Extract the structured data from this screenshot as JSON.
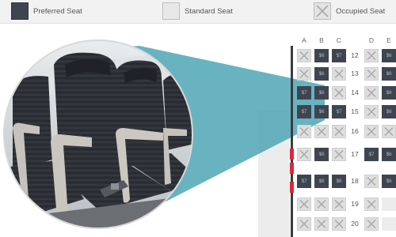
{
  "legend": {
    "preferred": "Preferred Seat",
    "standard": "Standard Seat",
    "occupied": "Occupied Seat"
  },
  "columns": [
    "A",
    "B",
    "C",
    "D",
    "E"
  ],
  "seat_label_text": "$6",
  "rows": [
    {
      "number": "12",
      "seats": [
        "occupied",
        "preferred",
        "preferred",
        "occupied",
        "preferred"
      ],
      "labels": [
        "",
        "$6",
        "$7",
        "",
        "$6"
      ]
    },
    {
      "number": "13",
      "seats": [
        "occupied",
        "preferred",
        "occupied",
        "occupied",
        "preferred"
      ],
      "labels": [
        "",
        "$6",
        "",
        "",
        "$6"
      ]
    },
    {
      "number": "14",
      "seats": [
        "preferred",
        "preferred",
        "occupied",
        "occupied",
        "preferred"
      ],
      "labels": [
        "$7",
        "$6",
        "",
        "",
        "$6"
      ]
    },
    {
      "number": "15",
      "seats": [
        "preferred",
        "preferred",
        "preferred",
        "occupied",
        "preferred"
      ],
      "labels": [
        "$7",
        "$6",
        "$7",
        "",
        "$6"
      ]
    },
    {
      "number": "16",
      "seats": [
        "occupied",
        "occupied",
        "occupied",
        "occupied",
        "occupied"
      ],
      "labels": [
        "",
        "",
        "",
        "",
        ""
      ]
    },
    {
      "number": "17",
      "seats": [
        "occupied",
        "preferred",
        "occupied",
        "preferred",
        "preferred"
      ],
      "labels": [
        "",
        "$6",
        "",
        "$7",
        "$6"
      ]
    },
    {
      "number": "18",
      "seats": [
        "preferred",
        "preferred",
        "preferred",
        "occupied",
        "preferred"
      ],
      "labels": [
        "$7",
        "$6",
        "$6",
        "",
        "$6"
      ]
    },
    {
      "number": "19",
      "seats": [
        "occupied",
        "occupied",
        "occupied",
        "occupied",
        "standard"
      ],
      "labels": [
        "",
        "",
        "",
        "",
        ""
      ]
    },
    {
      "number": "20",
      "seats": [
        "occupied",
        "occupied",
        "occupied",
        "occupied",
        "standard"
      ],
      "labels": [
        "",
        "",
        "",
        "",
        ""
      ]
    }
  ],
  "colors": {
    "preferred": "#3f4550",
    "standard": "#ececec",
    "occupied": "#dedede",
    "beam": "#4fa6b5",
    "exit": "#e0273a"
  }
}
